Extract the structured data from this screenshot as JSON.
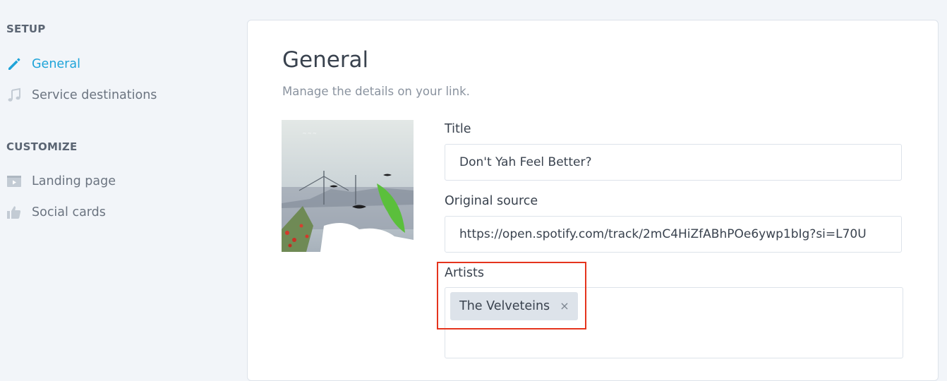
{
  "sidebar": {
    "sections": [
      {
        "title": "SETUP",
        "items": [
          {
            "label": "General",
            "icon": "pencil-icon",
            "active": true
          },
          {
            "label": "Service destinations",
            "icon": "music-note-icon",
            "active": false
          }
        ]
      },
      {
        "title": "CUSTOMIZE",
        "items": [
          {
            "label": "Landing page",
            "icon": "landing-page-icon",
            "active": false
          },
          {
            "label": "Social cards",
            "icon": "thumbs-up-icon",
            "active": false
          }
        ]
      }
    ]
  },
  "main": {
    "title": "General",
    "subtitle": "Manage the details on your link.",
    "fields": {
      "title": {
        "label": "Title",
        "value": "Don't Yah Feel Better?"
      },
      "source": {
        "label": "Original source",
        "value": "https://open.spotify.com/track/2mC4HiZfABhPOe6ywp1bIg?si=L70U"
      },
      "artists": {
        "label": "Artists",
        "tags": [
          "The Velveteins"
        ],
        "remove_glyph": "×"
      }
    }
  },
  "colors": {
    "accent": "#1fa4d9",
    "highlight": "#e5341d",
    "background": "#f2f5f9"
  }
}
